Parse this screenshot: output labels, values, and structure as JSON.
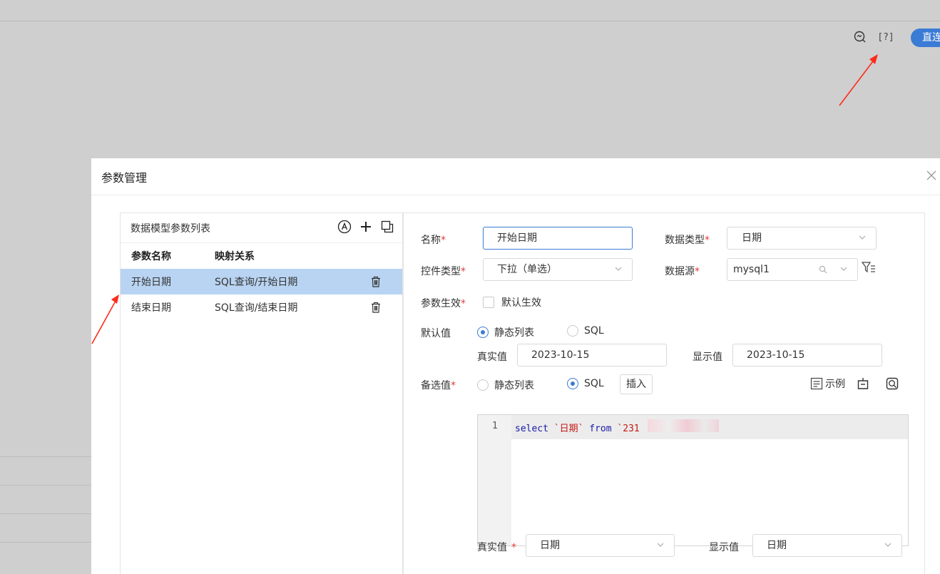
{
  "topbar": {
    "help_label": "[?]",
    "pill_label": "直连"
  },
  "dialog": {
    "title": "参数管理",
    "close_icon": "close-icon"
  },
  "param_list": {
    "title": "数据模型参数列表",
    "columns": [
      "参数名称",
      "映射关系"
    ],
    "rows": [
      {
        "name": "开始日期",
        "mapping": "SQL查询/开始日期",
        "selected": true
      },
      {
        "name": "结束日期",
        "mapping": "SQL查询/结束日期",
        "selected": false
      }
    ]
  },
  "form": {
    "name_label": "名称",
    "name_value": "开始日期",
    "data_type_label": "数据类型",
    "data_type_value": "日期",
    "control_type_label": "控件类型",
    "control_type_value": "下拉（单选）",
    "datasource_label": "数据源",
    "datasource_value": "mysql1",
    "param_effect_label": "参数生效",
    "default_effect_label": "默认生效",
    "default_value_label": "默认值",
    "default_static_option": "静态列表",
    "default_sql_option": "SQL",
    "real_value_label": "真实值",
    "real_value": "2023-10-15",
    "display_value_label": "显示值",
    "display_value": "2023-10-15",
    "alt_value_label": "备选值",
    "alt_static_option": "静态列表",
    "alt_sql_option": "SQL",
    "insert_button": "插入",
    "example_label": "示例",
    "sql_line_number": "1",
    "sql_keyword_select": "select",
    "sql_column": "`日期`",
    "sql_keyword_from": "from",
    "sql_table_partial": "`231",
    "bottom_real_label": "真实值",
    "bottom_real_value": "日期",
    "bottom_display_label": "显示值",
    "bottom_display_value": "日期"
  },
  "colors": {
    "accent": "#3a7bd5",
    "selected_row": "#b9d4f2",
    "required": "#e23c3c",
    "annotation_arrow": "#ff2a1a"
  }
}
